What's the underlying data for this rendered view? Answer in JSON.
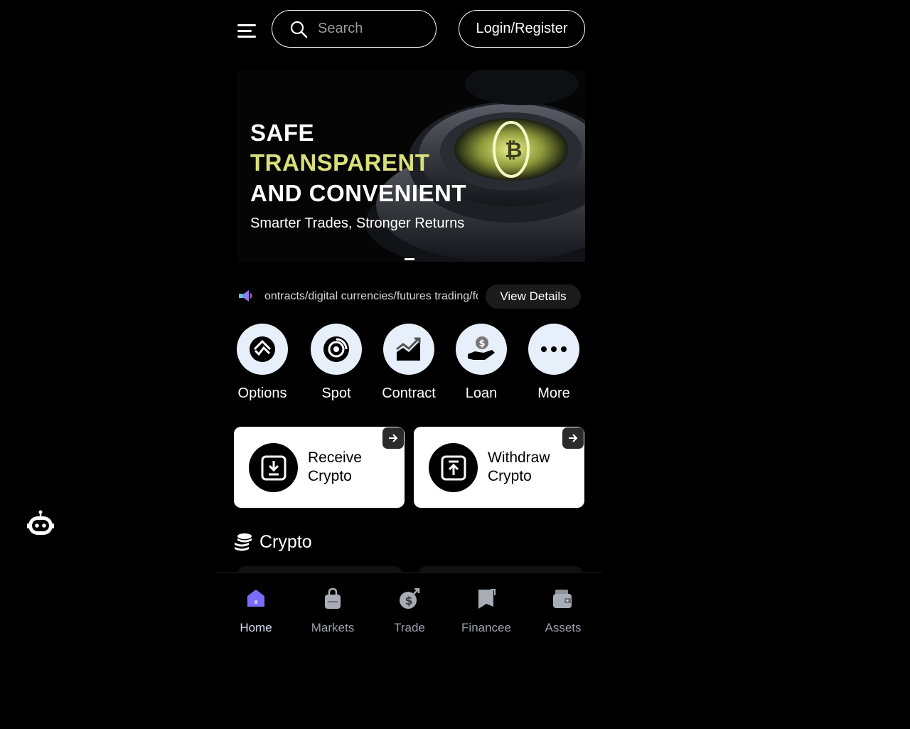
{
  "header": {
    "search_placeholder": "Search",
    "login_label": "Login/Register"
  },
  "banner": {
    "line1": "SAFE",
    "line2": "TRANSPARENT",
    "line3": "AND CONVENIENT",
    "subtitle": "Smarter Trades, Stronger Returns",
    "accent_color": "#d9e07a"
  },
  "notice": {
    "text": "ontracts/digital currencies/futures trading/fo",
    "button_label": "View Details"
  },
  "quick_actions": [
    {
      "label": "Options",
      "icon": "options-icon"
    },
    {
      "label": "Spot",
      "icon": "spot-icon"
    },
    {
      "label": "Contract",
      "icon": "contract-chart-icon"
    },
    {
      "label": "Loan",
      "icon": "loan-hand-dollar-icon"
    },
    {
      "label": "More",
      "icon": "more-dots-icon"
    }
  ],
  "cards": {
    "receive": {
      "line1": "Receive",
      "line2": "Crypto"
    },
    "withdraw": {
      "line1": "Withdraw",
      "line2": "Crypto"
    }
  },
  "section": {
    "title": "Crypto"
  },
  "bottom_nav": [
    {
      "label": "Home",
      "icon": "home-icon",
      "active": true
    },
    {
      "label": "Markets",
      "icon": "bag-icon",
      "active": false
    },
    {
      "label": "Trade",
      "icon": "trade-coin-icon",
      "active": false
    },
    {
      "label": "Financee",
      "icon": "finance-book-icon",
      "active": false
    },
    {
      "label": "Assets",
      "icon": "wallet-icon",
      "active": false
    }
  ],
  "colors": {
    "background": "#000000",
    "home_active": "#7b6cff",
    "icon_circle": "#e7effb"
  }
}
